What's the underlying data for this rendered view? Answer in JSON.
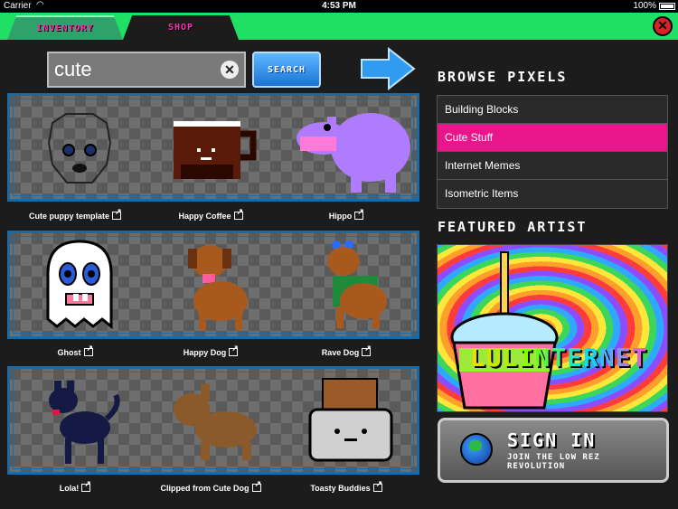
{
  "status": {
    "carrier": "Carrier",
    "time": "4:53 PM",
    "battery": "100%"
  },
  "tabs": [
    {
      "label": "INVENTORY"
    },
    {
      "label": "SHOP"
    }
  ],
  "search": {
    "value": "cute",
    "button": "SEARCH"
  },
  "items": [
    {
      "label": "Cute puppy template"
    },
    {
      "label": "Happy Coffee"
    },
    {
      "label": "Hippo"
    },
    {
      "label": "Ghost"
    },
    {
      "label": "Happy Dog"
    },
    {
      "label": "Rave Dog"
    },
    {
      "label": "Lola!"
    },
    {
      "label": "Clipped from Cute Dog"
    },
    {
      "label": "Toasty Buddies"
    }
  ],
  "browse": {
    "title": "BROWSE PIXELS",
    "items": [
      "Building Blocks",
      "Cute Stuff",
      "Internet Memes",
      "Isometric Items"
    ],
    "selected": "Cute Stuff"
  },
  "featured": {
    "title": "FEATURED ARTIST",
    "artist": "LULINTERNET"
  },
  "signin": {
    "title": "SIGN IN",
    "subtitle": "JOIN THE LOW REZ REVOLUTION"
  },
  "colors": {
    "accent_green": "#1fe065",
    "accent_pink": "#e8168a",
    "frame_blue": "#1a6aa5"
  }
}
